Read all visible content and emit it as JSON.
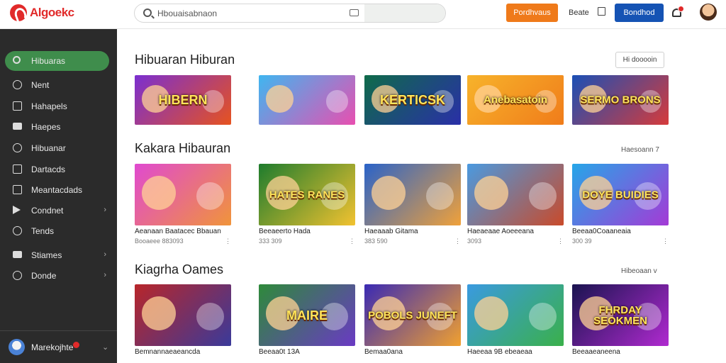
{
  "header": {
    "logo_text": "Algoekc",
    "search_placeholder": "Hbouaisabnaon",
    "orange_button": "Pordhvaus",
    "link": "Beate",
    "blue_button": "Bondhod"
  },
  "sidebar": {
    "items": [
      {
        "label": "Hibuaras",
        "icon": "search-icon",
        "active": true,
        "chevron": false
      },
      {
        "label": "Nent",
        "icon": "tag-icon",
        "active": false,
        "chevron": false
      },
      {
        "label": "Hahapels",
        "icon": "document-icon",
        "active": false,
        "chevron": false
      },
      {
        "label": "Haepes",
        "icon": "monitor-icon",
        "active": false,
        "chevron": false
      },
      {
        "label": "Hibuanar",
        "icon": "users-icon",
        "active": false,
        "chevron": false
      },
      {
        "label": "Dartacds",
        "icon": "calendar-icon",
        "active": false,
        "chevron": false
      },
      {
        "label": "Meantacdads",
        "icon": "chart-icon",
        "active": false,
        "chevron": false
      },
      {
        "label": "Condnet",
        "icon": "play-icon",
        "active": false,
        "chevron": true
      },
      {
        "label": "Tends",
        "icon": "clock-icon",
        "active": false,
        "chevron": false
      },
      {
        "label": "Stiames",
        "icon": "grid-icon",
        "active": false,
        "chevron": true
      },
      {
        "label": "Donde",
        "icon": "globe-icon",
        "active": false,
        "chevron": true
      }
    ],
    "user_name": "Marekojhte"
  },
  "sections": [
    {
      "title": "Hibuaran Hiburan",
      "action": "Hi dooooin",
      "cards": [
        {
          "thumb_text": "HIBERN",
          "colors": [
            "#7b2fd0",
            "#e6531f"
          ],
          "title": "",
          "meta": ""
        },
        {
          "thumb_text": "",
          "colors": [
            "#3fb6f0",
            "#e84fb0"
          ],
          "title": "",
          "meta": ""
        },
        {
          "thumb_text": "KERTICSK",
          "colors": [
            "#0f6b4a",
            "#2a2fa8"
          ],
          "title": "",
          "meta": ""
        },
        {
          "thumb_text": "Anebasatoin",
          "colors": [
            "#f7b32b",
            "#f07c1a"
          ],
          "title": "",
          "meta": ""
        },
        {
          "thumb_text": "SERMO BRONS",
          "colors": [
            "#1b4fb5",
            "#d63b3b"
          ],
          "title": "",
          "meta": ""
        }
      ]
    },
    {
      "title": "Kakara Hibauran",
      "action": "Haesoann 7",
      "cards": [
        {
          "thumb_text": "",
          "colors": [
            "#e04ad0",
            "#f0943a"
          ],
          "title": "Aeanaan Baatacec Bbauan",
          "meta": "Booaeee 883093"
        },
        {
          "thumb_text": "HATES RANES",
          "colors": [
            "#1e7c2d",
            "#f2c230"
          ],
          "title": "Beeaeerto Hada",
          "meta": "333 309"
        },
        {
          "thumb_text": "",
          "colors": [
            "#2a63c9",
            "#f0a13a"
          ],
          "title": "Haeaaab Gitama",
          "meta": "383 590"
        },
        {
          "thumb_text": "",
          "colors": [
            "#4a9ae0",
            "#c94a2a"
          ],
          "title": "Haeaeaae Aoeeeana",
          "meta": "3093"
        },
        {
          "thumb_text": "DOYE BUIDIES",
          "colors": [
            "#26a6e8",
            "#a43ad6"
          ],
          "title": "Beeaa0Coaaneaia",
          "meta": "300 39"
        }
      ]
    },
    {
      "title": "Kiagrha Oames",
      "action": "Hibeoaan v",
      "cards": [
        {
          "thumb_text": "",
          "colors": [
            "#b8262a",
            "#3a3a9a"
          ],
          "title": "Bemnannaeaeancda",
          "meta": ""
        },
        {
          "thumb_text": "MAIRE",
          "colors": [
            "#2e8a3a",
            "#6a3ac4"
          ],
          "title": "Beeaa0t 13A",
          "meta": ""
        },
        {
          "thumb_text": "POBOLS JUNEFT",
          "colors": [
            "#3a2ab4",
            "#f0a030"
          ],
          "title": "Bemaa0ana",
          "meta": ""
        },
        {
          "thumb_text": "",
          "colors": [
            "#3a9ae0",
            "#3ab04a"
          ],
          "title": "Haeeaa 9B ebeaeaa",
          "meta": ""
        },
        {
          "thumb_text": "FHRDAY SEOKMEN",
          "colors": [
            "#1a1450",
            "#b02ad0"
          ],
          "title": "Beeaaeaneena",
          "meta": ""
        }
      ]
    }
  ]
}
